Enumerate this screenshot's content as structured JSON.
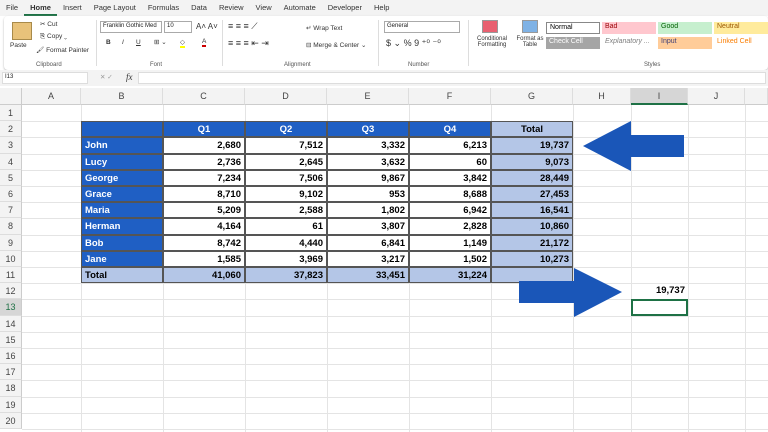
{
  "menu_tabs": [
    "File",
    "Home",
    "Insert",
    "Page Layout",
    "Formulas",
    "Data",
    "Review",
    "View",
    "Automate",
    "Developer",
    "Help"
  ],
  "clipboard": {
    "paste": "Paste",
    "cut": "Cut",
    "copy": "Copy",
    "format_painter": "Format Painter",
    "label": "Clipboard"
  },
  "font": {
    "name": "Franklin Gothic Med",
    "size": "10",
    "bold": "B",
    "italic": "I",
    "underline": "U",
    "label": "Font"
  },
  "alignment": {
    "wrap": "Wrap Text",
    "merge": "Merge & Center",
    "label": "Alignment"
  },
  "number": {
    "format": "General",
    "currency": "$",
    "percent": "%",
    "comma": "9",
    "label": "Number"
  },
  "styles": {
    "conditional": "Conditional Formatting",
    "format_table": "Format as Table",
    "label": "Styles",
    "items": [
      {
        "name": "Normal",
        "bg": "#ffffff",
        "fg": "#000000"
      },
      {
        "name": "Bad",
        "bg": "#ffc7ce",
        "fg": "#9c0006"
      },
      {
        "name": "Good",
        "bg": "#c6efce",
        "fg": "#006100"
      },
      {
        "name": "Neutral",
        "bg": "#ffeb9c",
        "fg": "#9c5700"
      },
      {
        "name": "Check Cell",
        "bg": "#a5a5a5",
        "fg": "#ffffff"
      },
      {
        "name": "Explanatory ...",
        "bg": "#ffffff",
        "fg": "#7f7f7f"
      },
      {
        "name": "Input",
        "bg": "#ffcc99",
        "fg": "#3f3f76"
      },
      {
        "name": "Linked Cell",
        "bg": "#ffffff",
        "fg": "#fa7d00"
      }
    ]
  },
  "formula_bar": {
    "name_box": "I13",
    "fx": "fx",
    "value": ""
  },
  "columns": [
    "A",
    "B",
    "C",
    "D",
    "E",
    "F",
    "G",
    "H",
    "I",
    "J"
  ],
  "rows": [
    "1",
    "2",
    "3",
    "4",
    "5",
    "6",
    "7",
    "8",
    "9",
    "10",
    "11",
    "12",
    "13",
    "14",
    "15",
    "16",
    "17",
    "18",
    "19",
    "20"
  ],
  "table": {
    "headers": [
      "Q1",
      "Q2",
      "Q3",
      "Q4",
      "Total"
    ],
    "data": [
      [
        "John",
        "2,680",
        "7,512",
        "3,332",
        "6,213",
        "19,737"
      ],
      [
        "Lucy",
        "2,736",
        "2,645",
        "3,632",
        "60",
        "9,073"
      ],
      [
        "George",
        "7,234",
        "7,506",
        "9,867",
        "3,842",
        "28,449"
      ],
      [
        "Grace",
        "8,710",
        "9,102",
        "953",
        "8,688",
        "27,453"
      ],
      [
        "Maria",
        "5,209",
        "2,588",
        "1,802",
        "6,942",
        "16,541"
      ],
      [
        "Herman",
        "4,164",
        "61",
        "3,807",
        "2,828",
        "10,860"
      ],
      [
        "Bob",
        "8,742",
        "4,440",
        "6,841",
        "1,149",
        "21,172"
      ],
      [
        "Jane",
        "1,585",
        "3,969",
        "3,217",
        "1,502",
        "10,273"
      ]
    ],
    "total_row": [
      "Total",
      "41,060",
      "37,823",
      "33,451",
      "31,224",
      ""
    ]
  },
  "result_cell": "19,737",
  "colors": {
    "header_blue": "#1f5fc4",
    "light_blue": "#b4c6e7",
    "arrow": "#1a56b8"
  }
}
